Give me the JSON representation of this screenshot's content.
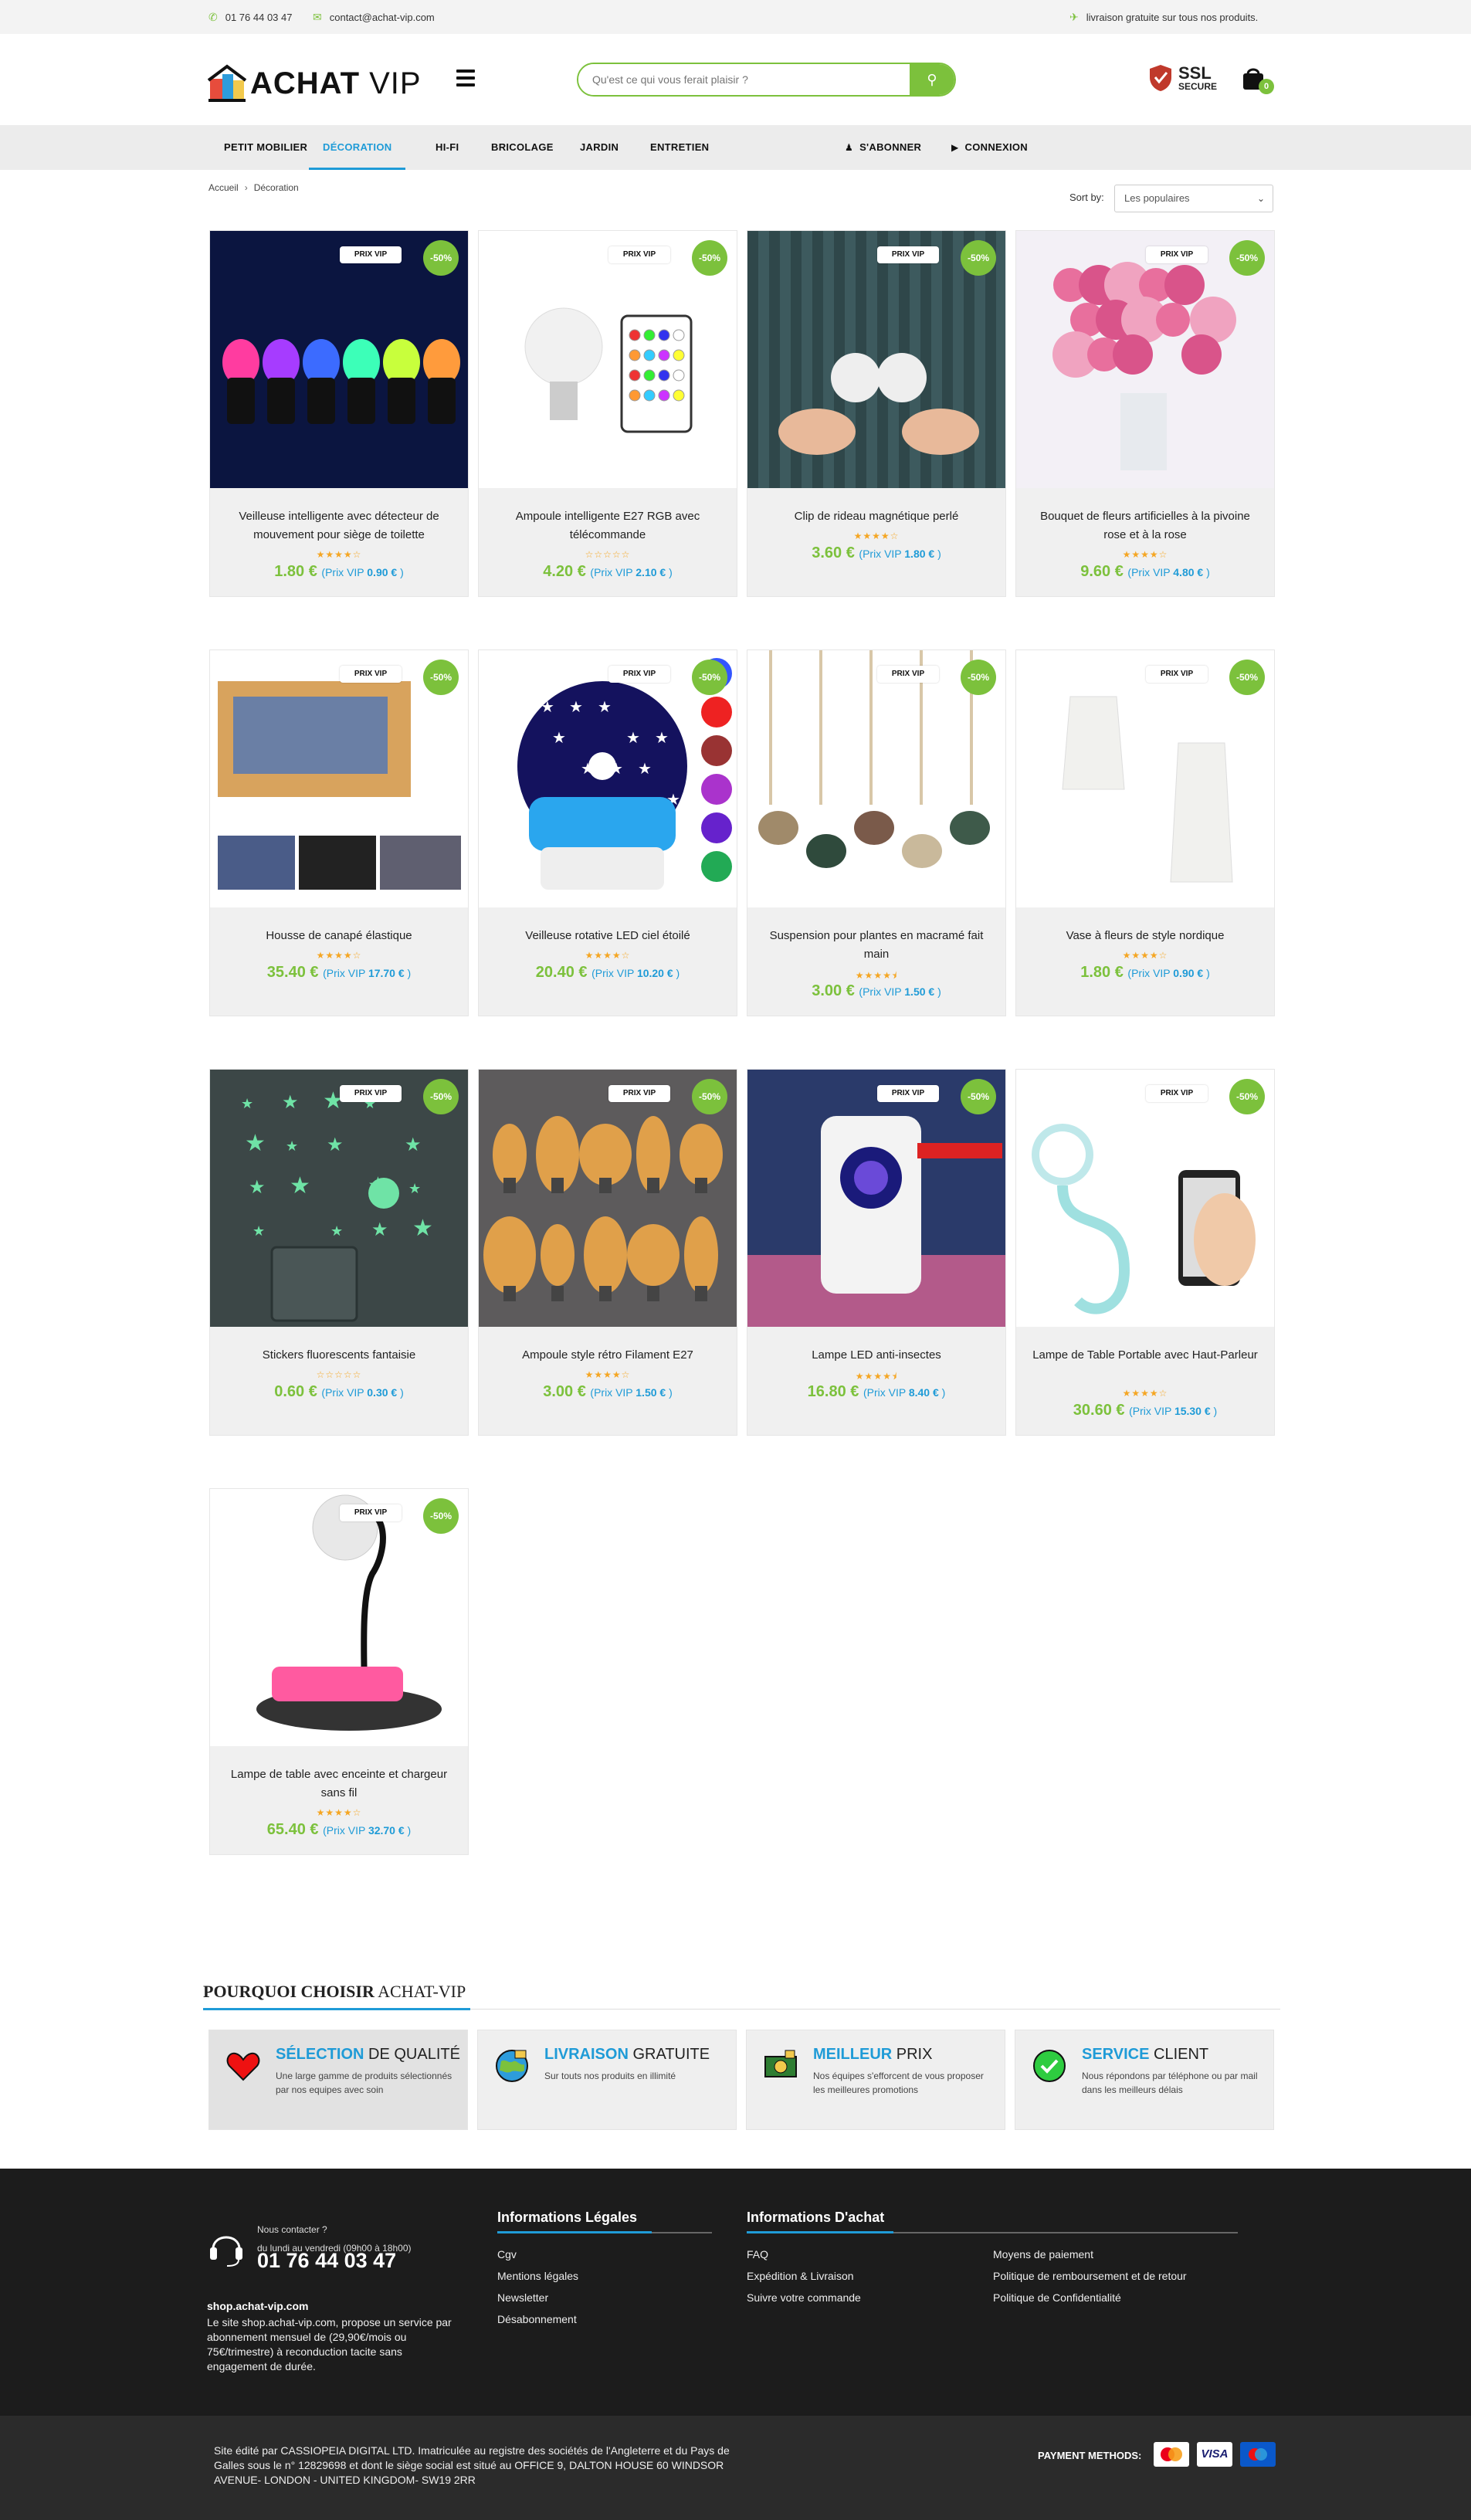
{
  "topbar": {
    "phone": "01 76 44 03 47",
    "email": "contact@achat-vip.com",
    "shipping": "livraison gratuite sur tous nos produits."
  },
  "header": {
    "logo_bold": "ACHAT",
    "logo_light": " VIP",
    "search_placeholder": "Qu'est ce qui vous ferait plaisir ?",
    "ssl_big": "SSL",
    "ssl_small": "SECURE",
    "cart_count": "0"
  },
  "nav": {
    "items": [
      "PETIT MOBILIER",
      "DÉCORATION",
      "HI-FI",
      "BRICOLAGE",
      "JARDIN",
      "ENTRETIEN"
    ],
    "active": "DÉCORATION",
    "subscribe": "S'ABONNER",
    "login": "CONNEXION"
  },
  "breadcrumb": {
    "home": "Accueil",
    "current": "Décoration"
  },
  "sort": {
    "label": "Sort by:",
    "value": "Les populaires"
  },
  "badges": {
    "vip": "PRIX VIP",
    "discount": "-50%",
    "vip_prefix": "Prix VIP",
    "currency": "€"
  },
  "products": [
    {
      "title": "Veilleuse intelligente avec détecteur de mouvement pour siège de toilette",
      "price": "1.80 €",
      "vip_price": "0.90 €",
      "rating": 4
    },
    {
      "title": "Ampoule intelligente E27 RGB avec télécommande",
      "price": "4.20 €",
      "vip_price": "2.10 €",
      "rating": 0
    },
    {
      "title": "Clip de rideau magnétique perlé",
      "price": "3.60 €",
      "vip_price": "1.80 €",
      "rating": 4
    },
    {
      "title": "Bouquet de fleurs artificielles à la pivoine rose et à la rose",
      "price": "9.60 €",
      "vip_price": "4.80 €",
      "rating": 4
    },
    {
      "title": "Housse de canapé élastique",
      "price": "35.40 €",
      "vip_price": "17.70 €",
      "rating": 4
    },
    {
      "title": "Veilleuse rotative LED ciel étoilé",
      "price": "20.40 €",
      "vip_price": "10.20 €",
      "rating": 4
    },
    {
      "title": "Suspension pour plantes en macramé fait main",
      "price": "3.00 €",
      "vip_price": "1.50 €",
      "rating": 4.5
    },
    {
      "title": "Vase à fleurs de style nordique",
      "price": "1.80 €",
      "vip_price": "0.90 €",
      "rating": 4
    },
    {
      "title": "Stickers fluorescents fantaisie",
      "price": "0.60 €",
      "vip_price": "0.30 €",
      "rating": 0
    },
    {
      "title": "Ampoule style rétro Filament E27",
      "price": "3.00 €",
      "vip_price": "1.50 €",
      "rating": 4
    },
    {
      "title": "Lampe LED anti-insectes",
      "price": "16.80 €",
      "vip_price": "8.40 €",
      "rating": 4.5
    },
    {
      "title": "Lampe de Table Portable avec Haut-Parleur",
      "price": "30.60 €",
      "vip_price": "15.30 €",
      "rating": 4
    },
    {
      "title": "Lampe de table avec enceinte et chargeur sans fil",
      "price": "65.40 €",
      "vip_price": "32.70 €",
      "rating": 4
    }
  ],
  "why": {
    "title_bold": "POURQUOI CHOISIR",
    "title_light": " ACHAT-VIP",
    "boxes": [
      {
        "hl": "SÉLECTION",
        "rest": " DE QUALITÉ",
        "text": "Une large gamme de produits sélectionnés par nos equipes avec soin"
      },
      {
        "hl": "LIVRAISON",
        "rest": " GRATUITE",
        "text": "Sur touts nos produits en illimité"
      },
      {
        "hl": "MEILLEUR",
        "rest": " PRIX",
        "text": "Nos équipes s'efforcent de vous proposer les meilleures promotions"
      },
      {
        "hl": "SERVICE",
        "rest": " CLIENT",
        "text": "Nous répondons par téléphone ou par mail dans les meilleurs délais"
      }
    ]
  },
  "footer": {
    "contact_q": "Nous contacter ?",
    "hours": "du lundi au vendredi (09h00 à 18h00)",
    "phone": "01 76 44 03 47",
    "site": "shop.achat-vip.com",
    "about": "Le site shop.achat-vip.com, propose un service par abonnement mensuel de (29,90€/mois ou 75€/trimestre) à reconduction tacite sans engagement de durée.",
    "legal_title": "Informations Légales",
    "legal_links": [
      "Cgv",
      "Mentions légales",
      "Newsletter",
      "Désabonnement"
    ],
    "purchase_title": "Informations D'achat",
    "purchase_links_a": [
      "FAQ",
      "Expédition & Livraison",
      "Suivre votre commande"
    ],
    "purchase_links_b": [
      "Moyens de paiement",
      "Politique de remboursement et de retour",
      "Politique de Confidentialité"
    ]
  },
  "bottom": {
    "legal": "Site édité par CASSIOPEIA DIGITAL LTD. Imatriculée au registre des sociétés de l'Angleterre et du Pays de Galles sous le n° 12829698 et dont le siège social est situé au OFFICE 9, DALTON HOUSE 60 WINDSOR AVENUE- LONDON - UNITED KINGDOM- SW19 2RR",
    "payment_label": "PAYMENT METHODS:",
    "payment_methods": [
      "mastercard-icon",
      "visa-icon",
      "maestro-icon"
    ]
  },
  "colors": {
    "accent_green": "#7cc13c",
    "accent_blue": "#1f9bd7",
    "footer_bg": "#1c1c1c"
  }
}
